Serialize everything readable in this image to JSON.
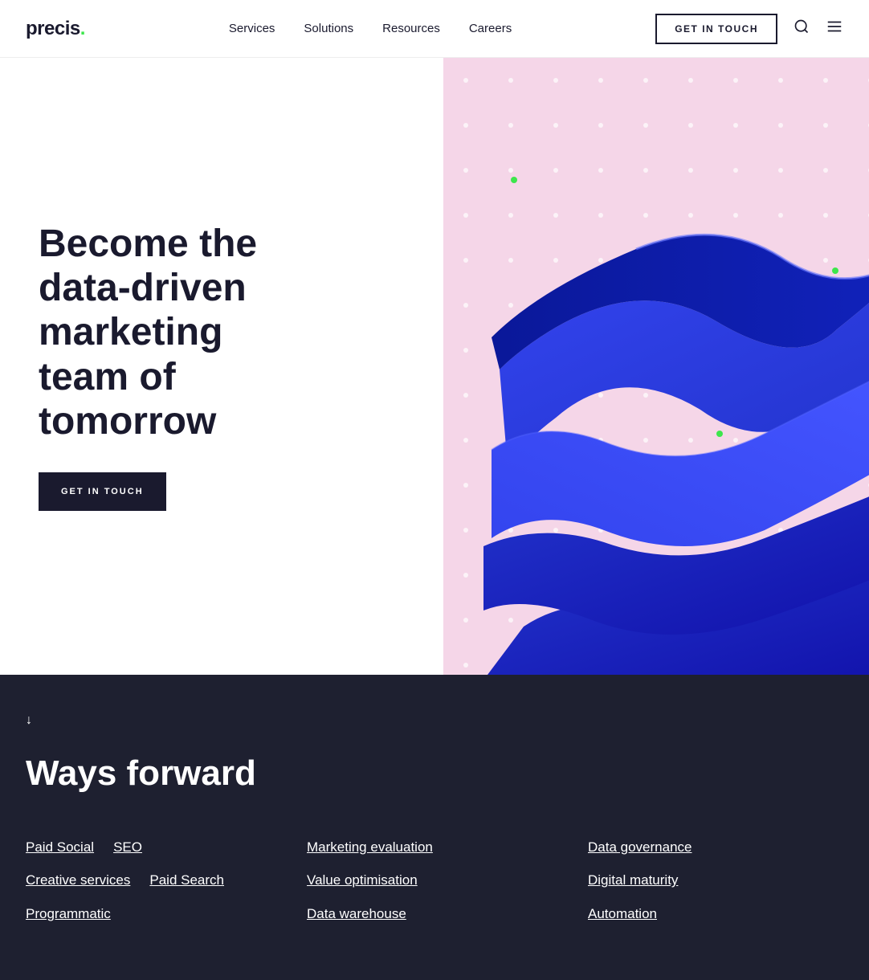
{
  "header": {
    "logo_text": "precis.",
    "logo_dot": ".",
    "nav_items": [
      "Services",
      "Solutions",
      "Resources",
      "Careers"
    ],
    "cta_label": "GET IN TOUCH"
  },
  "hero": {
    "title": "Become the data-driven marketing team of tomorrow",
    "cta_label": "GET IN TOUCH"
  },
  "dark": {
    "heading": "Ways forward",
    "scroll_arrow": "↓",
    "columns": [
      {
        "rows": [
          [
            "Paid Social",
            "SEO"
          ],
          [
            "Creative services",
            "Paid Search"
          ],
          [
            "Programmatic"
          ]
        ]
      },
      {
        "rows": [
          [
            "Marketing evaluation"
          ],
          [
            "Value optimisation"
          ],
          [
            "Data warehouse"
          ]
        ]
      },
      {
        "rows": [
          [
            "Data governance"
          ],
          [
            "Digital maturity"
          ],
          [
            "Automation"
          ]
        ]
      }
    ]
  }
}
